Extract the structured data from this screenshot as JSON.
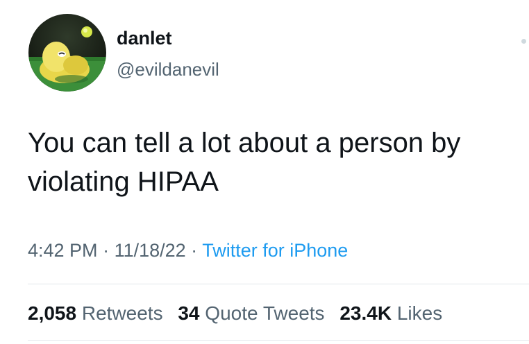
{
  "user": {
    "display_name": "danlet",
    "handle": "@evildanevil",
    "avatar_icon": "yellow-creature-on-grass-avatar"
  },
  "tweet": {
    "text_line1": "You can tell a lot about a person by",
    "text_line2": "violating HIPAA"
  },
  "meta": {
    "time": "4:42 PM",
    "sep1": " · ",
    "date": "11/18/22",
    "sep2": " · ",
    "source": "Twitter for iPhone"
  },
  "stats": {
    "retweets_count": "2,058",
    "retweets_label": "Retweets",
    "quotes_count": "34",
    "quotes_label": "Quote Tweets",
    "likes_count": "23.4K",
    "likes_label": "Likes"
  },
  "colors": {
    "text_primary": "#0f1419",
    "text_secondary": "#536471",
    "link": "#1d9bf0",
    "divider": "#e1e6ea"
  }
}
